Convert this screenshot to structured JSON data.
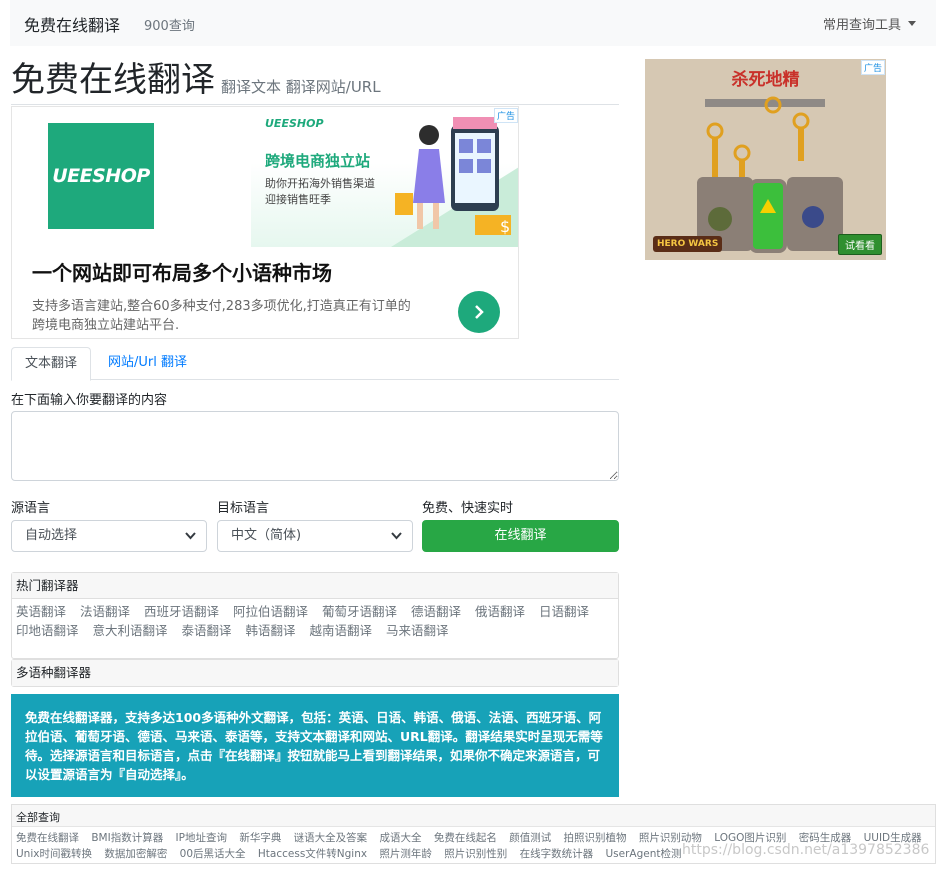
{
  "navbar": {
    "brand": "免费在线翻译",
    "count": "900查询",
    "tools_label": "常用查询工具"
  },
  "header": {
    "title": "免费在线翻译",
    "subtitle": "翻译文本 翻译网站/URL"
  },
  "ad_left": {
    "logo_text": "UEESHOP",
    "banner_brand": "UEESHOP",
    "banner_headline": "跨境电商独立站",
    "banner_sub1": "助你开拓海外销售渠道",
    "banner_sub2": "迎接销售旺季",
    "badge": "广告",
    "headline": "一个网站即可布局多个小语种市场",
    "desc_line1": "支持多语言建站,整合60多种支付,283多项优化,打造真正有订单的",
    "desc_line2": "跨境电商独立站建站平台."
  },
  "ad_right": {
    "title": "杀死地精",
    "badge": "广告",
    "logo": "HERO WARS",
    "cta": "试看看"
  },
  "tabs": [
    {
      "label": "文本翻译"
    },
    {
      "label": "网站/Url 翻译"
    }
  ],
  "form": {
    "input_label": "在下面输入你要翻译的内容",
    "input_value": "",
    "source_label": "源语言",
    "source_value": "自动选择",
    "target_label": "目标语言",
    "target_value": "中文（简体)",
    "action_label": "免费、快速实时",
    "translate_button": "在线翻译"
  },
  "hot": {
    "header": "热门翻译器",
    "items": [
      "英语翻译",
      "法语翻译",
      "西班牙语翻译",
      "阿拉伯语翻译",
      "葡萄牙语翻译",
      "德语翻译",
      "俄语翻译",
      "日语翻译",
      "印地语翻译",
      "意大利语翻译",
      "泰语翻译",
      "韩语翻译",
      "越南语翻译",
      "马来语翻译"
    ]
  },
  "multi": {
    "header": "多语种翻译器",
    "info": "免费在线翻译器，支持多达100多语种外文翻译，包括：英语、日语、韩语、俄语、法语、西班牙语、阿拉伯语、葡萄牙语、德语、马来语、泰语等，支持文本翻译和网站、URL翻译。翻译结果实时呈现无需等待。选择源语言和目标语言，点击『在线翻译』按钮就能马上看到翻译结果，如果你不确定来源语言，可以设置源语言为『自动选择』。"
  },
  "all": {
    "header": "全部查询",
    "items": [
      "免费在线翻译",
      "BMI指数计算器",
      "IP地址查询",
      "新华字典",
      "谜语大全及答案",
      "成语大全",
      "免费在线起名",
      "颜值测试",
      "拍照识别植物",
      "照片识别动物",
      "LOGO图片识别",
      "密码生成器",
      "UUID生成器",
      "Unix时间戳转换",
      "数据加密解密",
      "00后黑话大全",
      "Htaccess文件转Nginx",
      "照片测年龄",
      "照片识别性别",
      "在线字数统计器",
      "UserAgent检测"
    ]
  },
  "watermark": "https://blog.csdn.net/a1397852386",
  "colors": {
    "primary_link": "#007bff",
    "success": "#28a745",
    "info": "#17a2b8",
    "ad_green": "#1ea97c"
  }
}
